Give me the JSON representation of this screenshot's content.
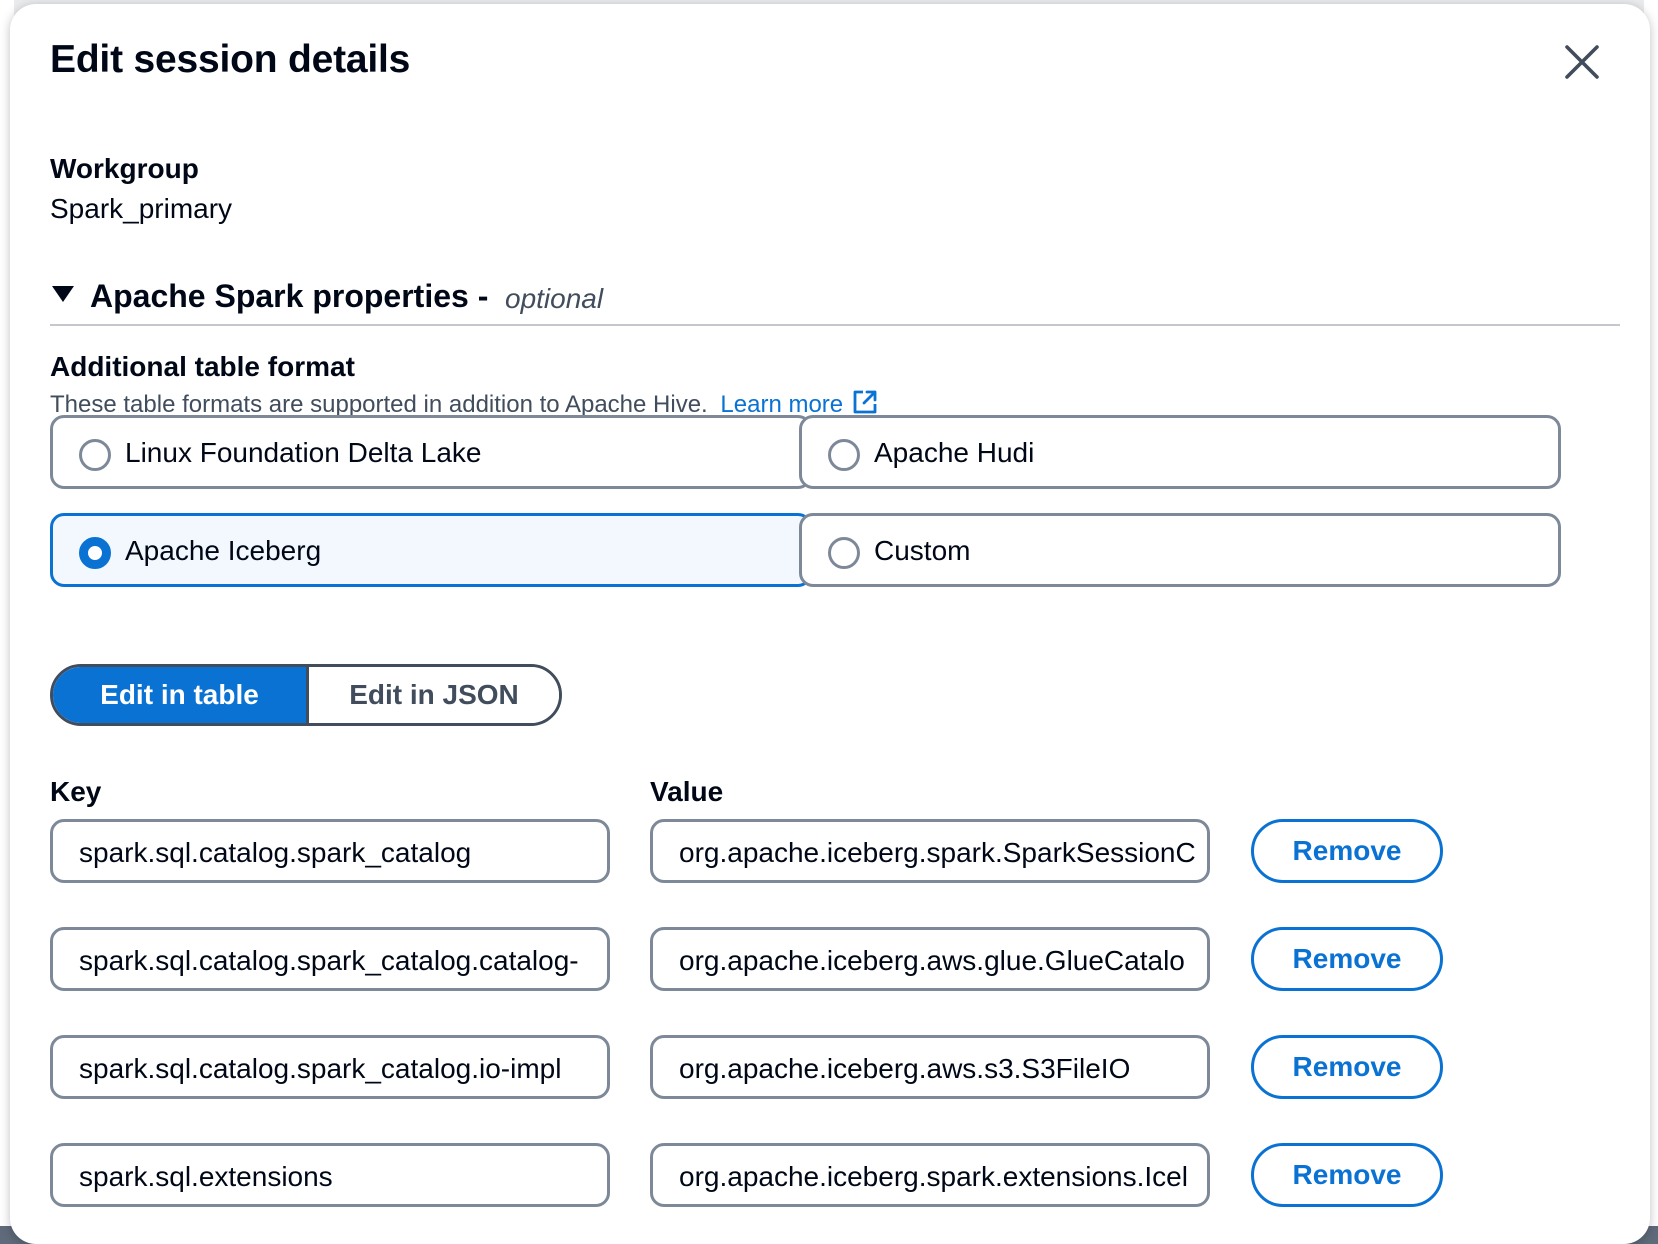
{
  "dialog": {
    "title": "Edit session details",
    "close_icon": "close-icon"
  },
  "workgroup": {
    "label": "Workgroup",
    "value": "Spark_primary"
  },
  "spark_properties": {
    "title": "Apache Spark properties -",
    "optional": "optional",
    "expanded": true
  },
  "table_format": {
    "label": "Additional table format",
    "description": "These table formats are supported in addition to Apache Hive.",
    "learn_more": "Learn more",
    "options": [
      {
        "label": "Linux Foundation Delta Lake",
        "selected": false
      },
      {
        "label": "Apache Hudi",
        "selected": false
      },
      {
        "label": "Apache Iceberg",
        "selected": true
      },
      {
        "label": "Custom",
        "selected": false
      }
    ]
  },
  "edit_mode": {
    "table_label": "Edit in table",
    "json_label": "Edit in JSON",
    "active": "table"
  },
  "properties": {
    "key_header": "Key",
    "value_header": "Value",
    "remove_label": "Remove",
    "rows": [
      {
        "key": "spark.sql.catalog.spark_catalog",
        "value": "org.apache.iceberg.spark.SparkSessionC"
      },
      {
        "key": "spark.sql.catalog.spark_catalog.catalog-",
        "value": "org.apache.iceberg.aws.glue.GlueCatalo"
      },
      {
        "key": "spark.sql.catalog.spark_catalog.io-impl",
        "value": "org.apache.iceberg.aws.s3.S3FileIO"
      },
      {
        "key": "spark.sql.extensions",
        "value": "org.apache.iceberg.spark.extensions.Icel"
      }
    ]
  },
  "colors": {
    "accent": "#0972d3",
    "text": "#000716",
    "secondary_text": "#414d5c",
    "border": "#7d8998",
    "selected_bg": "#f2f8fd"
  }
}
